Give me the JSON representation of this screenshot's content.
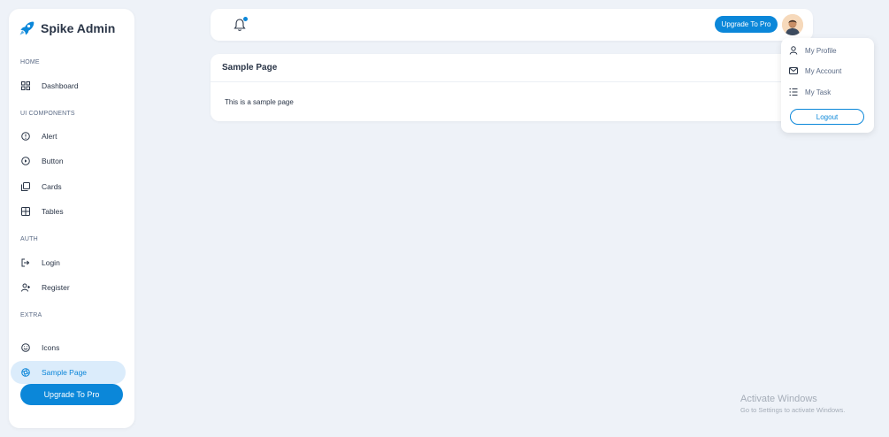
{
  "brand": {
    "name": "Spike Admin"
  },
  "sidebar": {
    "sections": [
      "HOME",
      "UI COMPONENTS",
      "AUTH",
      "EXTRA"
    ],
    "items": [
      {
        "label": "Dashboard",
        "icon": "dashboard-icon"
      },
      {
        "label": "Alert",
        "icon": "alert-circle-icon"
      },
      {
        "label": "Button",
        "icon": "button-circle-icon"
      },
      {
        "label": "Cards",
        "icon": "cards-icon"
      },
      {
        "label": "Tables",
        "icon": "table-icon"
      },
      {
        "label": "Login",
        "icon": "login-icon"
      },
      {
        "label": "Register",
        "icon": "user-plus-icon"
      },
      {
        "label": "Icons",
        "icon": "smiley-icon"
      },
      {
        "label": "Sample Page",
        "icon": "aperture-icon",
        "active": true
      }
    ],
    "upgrade_label": "Upgrade To Pro"
  },
  "header": {
    "upgrade_label": "Upgrade To Pro",
    "notification_icon": "bell-icon"
  },
  "profile_menu": {
    "items": [
      {
        "label": "My Profile",
        "icon": "user-icon"
      },
      {
        "label": "My Account",
        "icon": "mail-icon"
      },
      {
        "label": "My Task",
        "icon": "list-check-icon"
      }
    ],
    "logout_label": "Logout"
  },
  "main": {
    "title": "Sample Page",
    "body": "This is a sample page"
  },
  "watermark": {
    "title": "Activate Windows",
    "subtitle": "Go to Settings to activate Windows."
  },
  "colors": {
    "accent": "#0b87d9",
    "background": "#eef2f8",
    "active_bg": "#dbecfb"
  }
}
